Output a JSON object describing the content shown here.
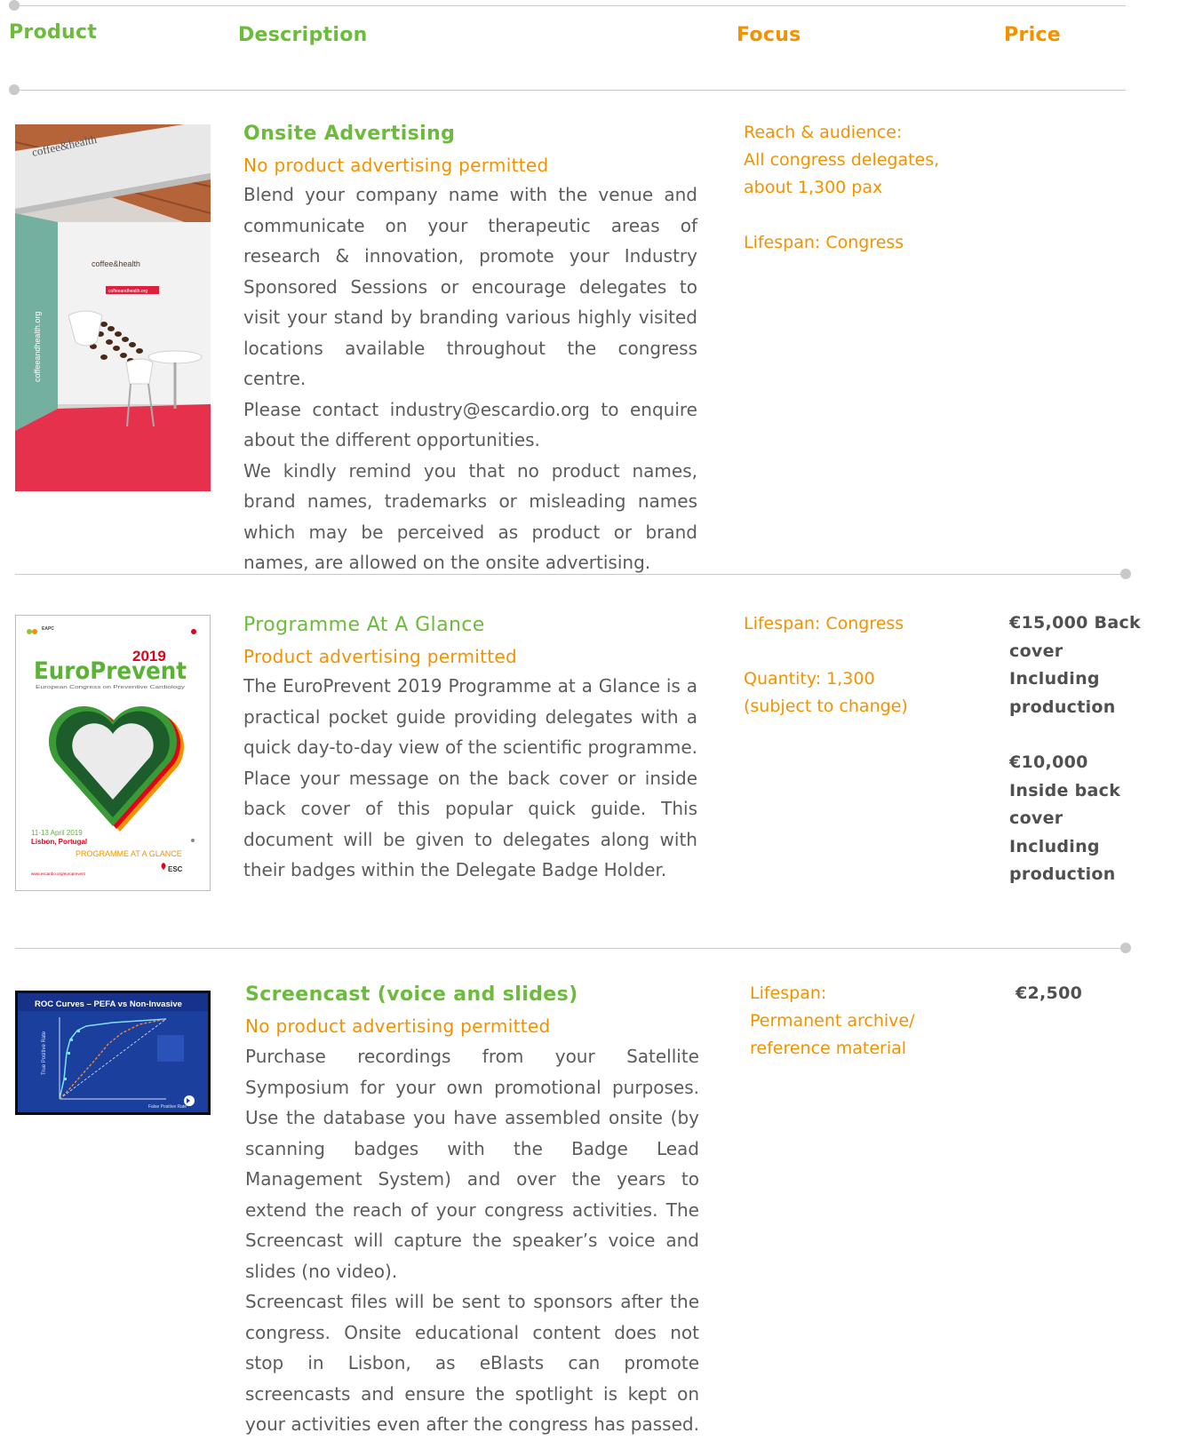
{
  "header": {
    "product": "Product",
    "description": "Description",
    "focus": "Focus",
    "price": "Price"
  },
  "items": [
    {
      "title": "Onsite Advertising",
      "subtitle": "No product advertising permitted",
      "paragraphs": [
        "Blend your company name with the venue and communicate on your therapeutic areas of research & innovation, promote your Industry Sponsored Sessions or encourage delegates to visit your stand by branding various highly visited locations available throughout the congress centre.",
        "Please contact industry@escardio.org to enquire about the different opportunities.",
        "We kindly remind you that no product names, brand names, trademarks or misleading names which may be perceived as product or brand names, are allowed on the onsite advertising."
      ],
      "focus": [
        "Reach & audience:\nAll congress delegates,\nabout 1,300 pax",
        "Lifespan: Congress"
      ],
      "price": [],
      "image": {
        "booth_logo_1": "coffee&health",
        "booth_logo_2": "coffee&health",
        "booth_side_url": "coffeeandhealth.org",
        "booth_button_text": "coffeeandhealth.org"
      }
    },
    {
      "title": "Programme At A Glance",
      "subtitle": "Product advertising permitted",
      "paragraphs": [
        "The EuroPrevent 2019 Programme at a Glance is a practical pocket guide providing delegates with a quick day-to-day view of the scientific programme. Place your message on the back cover or inside back cover of this popular quick guide. This document will be given to delegates along with their badges within the Delegate Badge Holder."
      ],
      "focus": [
        "Lifespan: Congress",
        "Quantity:  1,300\n(subject to change)"
      ],
      "price": [
        "€15,000 Back\ncover\nIncluding\nproduction",
        "€10,000\nInside back\ncover\nIncluding\nproduction"
      ],
      "image": {
        "org_tag": "EAPC",
        "year": "2019",
        "brand": "EuroPrevent",
        "tagline": "European Congress on Preventive Cardiology",
        "dates": "11-13 April 2019",
        "location": "Lisbon, Portugal",
        "doc_name": "PROGRAMME AT A GLANCE",
        "esc": "ESC",
        "url": "www.escardio.org/europrevent"
      }
    },
    {
      "title": "Screencast (voice and slides)",
      "subtitle": "No product advertising permitted",
      "paragraphs": [
        "Purchase recordings from your Satellite Symposium for your own promotional purposes. Use the database you have assembled onsite (by scanning badges with the Badge Lead Management System) and over the years to extend the reach of your congress activities. The Screencast will capture the speaker’s voice and slides (no video).",
        "Screencast files will be sent to sponsors after the congress. Onsite educational content does not stop in Lisbon, as eBlasts can promote screencasts and ensure the spotlight is kept on your activities even after the congress has passed."
      ],
      "focus": [
        "Lifespan:\nPermanent archive/\nreference material"
      ],
      "price": [
        "€2,500"
      ],
      "image": {
        "slide_title": "ROC Curves – PEFA vs Non-Invasive",
        "y_label": "True Positive Rate",
        "x_label": "False Positive Rate"
      }
    }
  ],
  "colors": {
    "green": "#6cbb3c",
    "orange": "#f39200",
    "text": "#5c5c5c",
    "rule": "#c9c9c9"
  }
}
